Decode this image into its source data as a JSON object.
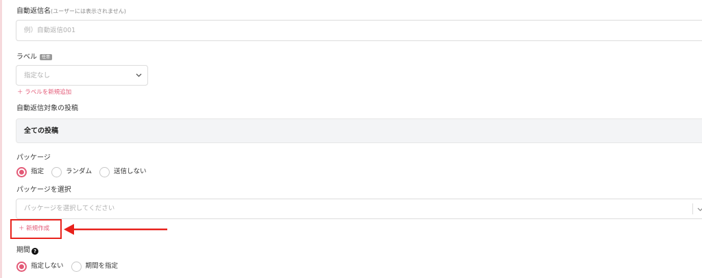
{
  "form": {
    "name_field": {
      "label": "自動返信名",
      "hint": "(ユーザーには表示されません)",
      "placeholder": "例）自動返信001"
    },
    "label_field": {
      "label": "ラベル",
      "badge": "任意",
      "placeholder": "指定なし",
      "add_link": "＋ ラベルを新規追加"
    },
    "target_field": {
      "label": "自動返信対象の投稿",
      "value": "全ての投稿"
    },
    "package_field": {
      "label": "パッケージ",
      "options": [
        "指定",
        "ランダム",
        "送信しない"
      ],
      "selected": "指定"
    },
    "package_select": {
      "label": "パッケージを選択",
      "placeholder": "パッケージを選択してください",
      "create_link": "＋ 新規作成"
    },
    "period_field": {
      "label": "期間",
      "options": [
        "指定しない",
        "期間を指定"
      ],
      "selected": "指定しない"
    }
  },
  "colors": {
    "accent": "#e35a77",
    "annotation": "#e8211b"
  }
}
